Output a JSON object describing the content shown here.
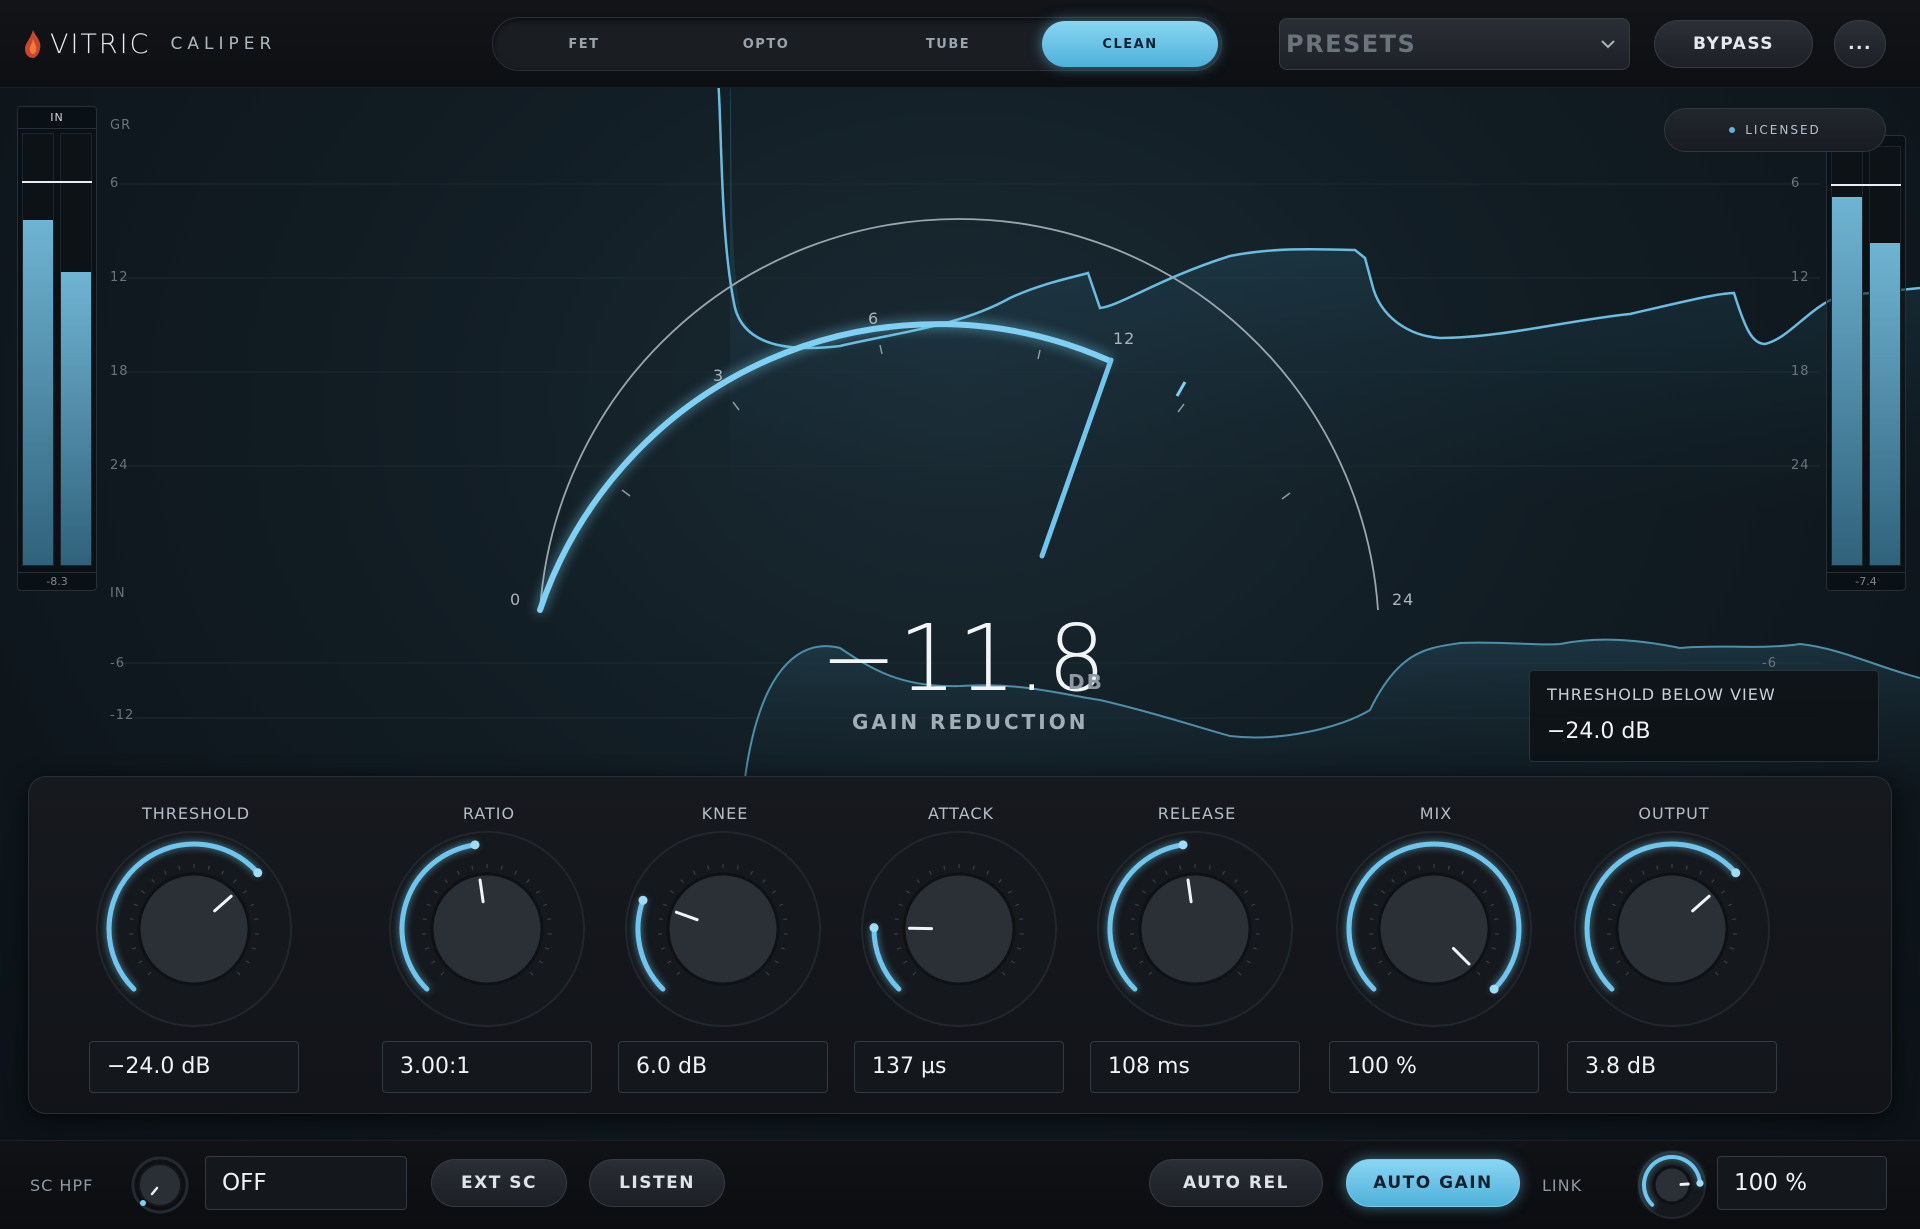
{
  "brand": {
    "name": "VITRIC",
    "product": "CALIPER"
  },
  "modes": [
    {
      "label": "FET",
      "active": false
    },
    {
      "label": "OPTO",
      "active": false
    },
    {
      "label": "TUBE",
      "active": false
    },
    {
      "label": "CLEAN",
      "active": true
    }
  ],
  "toolbar": {
    "presets_label": "PRESETS",
    "bypass_label": "BYPASS",
    "more_label": "..."
  },
  "license": {
    "label": "LICENSED"
  },
  "input_meter": {
    "header": "IN",
    "value": "-8.3",
    "level_left": 0.8,
    "level_right": 0.68,
    "peak": 0.89
  },
  "output_meter": {
    "value": "-7.4",
    "level_left": 0.88,
    "level_right": 0.77,
    "peak": 0.91
  },
  "scale": {
    "gr_label": "GR",
    "gr_ticks": [
      "6",
      "12",
      "18",
      "24"
    ],
    "in_label": "IN",
    "in_ticks": [
      "-6",
      "-12"
    ],
    "right_ticks": [
      "6",
      "12",
      "18",
      "24"
    ],
    "right_lower_tick": "-6"
  },
  "gr_meter": {
    "labels": [
      "0",
      "3",
      "6",
      "12",
      "24"
    ],
    "value": "−11.8",
    "unit": "DB",
    "caption": "GAIN REDUCTION"
  },
  "threshold_tip": {
    "title": "THRESHOLD BELOW VIEW",
    "value": "−24.0 dB"
  },
  "knobs": [
    {
      "label": "THRESHOLD",
      "value": "−24.0 dB",
      "fill": 0.68
    },
    {
      "label": "RATIO",
      "value": "3.00:1",
      "fill": 0.47
    },
    {
      "label": "KNEE",
      "value": "6.0 dB",
      "fill": 0.24
    },
    {
      "label": "ATTACK",
      "value": "137 µs",
      "fill": 0.17
    },
    {
      "label": "RELEASE",
      "value": "108 ms",
      "fill": 0.47
    },
    {
      "label": "MIX",
      "value": "100 %",
      "fill": 1.0
    },
    {
      "label": "OUTPUT",
      "value": "3.8 dB",
      "fill": 0.68
    }
  ],
  "bottom": {
    "sc_hpf_label": "SC HPF",
    "sc_hpf_value": "OFF",
    "ext_sc_label": "EXT SC",
    "listen_label": "LISTEN",
    "auto_rel_label": "AUTO REL",
    "auto_gain_label": "AUTO GAIN",
    "link_label": "LINK",
    "link_value": "100 %",
    "link_fill": 0.82
  },
  "colors": {
    "accent": "#6fc6ec",
    "background": "#0b0d11",
    "panel": "#16191e"
  }
}
